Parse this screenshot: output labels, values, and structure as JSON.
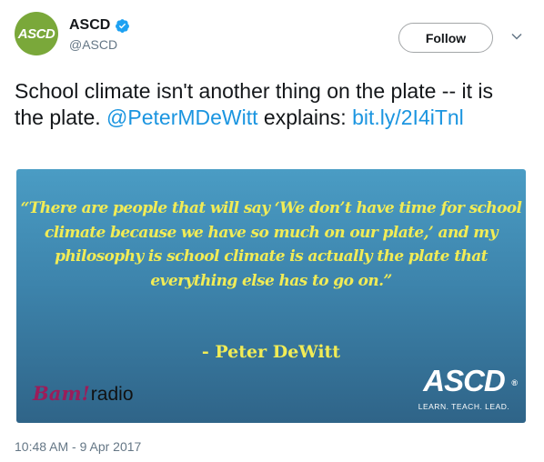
{
  "account": {
    "avatar_text": "ASCD",
    "display_name": "ASCD",
    "handle": "@ASCD",
    "verified_icon": "verified-badge-icon"
  },
  "actions": {
    "follow_label": "Follow",
    "more_icon": "chevron-down-icon"
  },
  "tweet": {
    "text_part1": "School climate isn't another thing on the plate -- it is the plate. ",
    "mention": "@PeterMDeWitt",
    "text_part2": " explains: ",
    "link": "bit.ly/2I4iTnl"
  },
  "card": {
    "quote": "“There are people that will say ‘We don’t have time for school climate because we have so much on our plate,’ and my philosophy is school climate is actually the plate that everything else has to go on.”",
    "attribution": "- Peter DeWitt",
    "bam_logo_bam": "Bam!",
    "bam_logo_radio": "radio",
    "ascd_logo_text": "ASCD",
    "ascd_tagline": "LEARN. TEACH. LEAD.",
    "colors": {
      "background_top": "#4a9cc4",
      "background_bottom": "#2f6488",
      "quote_text": "#f1ec56"
    }
  },
  "timestamp": "10:48 AM - 9 Apr 2017",
  "colors": {
    "link": "#1b95e0",
    "avatar_bg": "#7aa83a",
    "secondary_text": "#657786"
  }
}
